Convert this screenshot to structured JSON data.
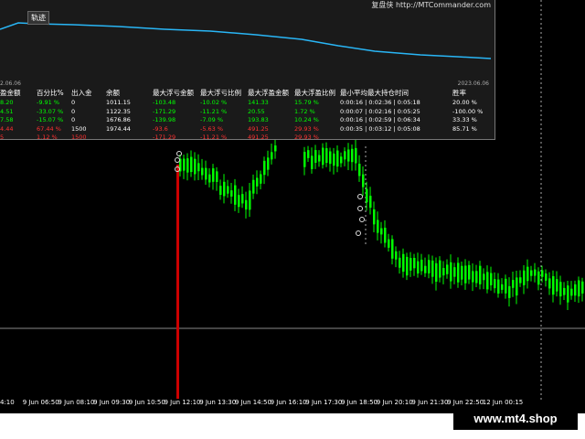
{
  "panel": {
    "title": "轨迹",
    "link": "复盘侠 http://MTCommander.com",
    "date_left": "2.06.06",
    "date_right": "2023.06.06"
  },
  "stats": {
    "headers": [
      "盈金额",
      "百分比%",
      "出入金",
      "余额",
      "最大浮亏金额",
      "最大浮亏比例",
      "最大浮盈金额",
      "最大浮盈比例",
      "最小平均最大持仓时间",
      "胜率"
    ],
    "rows": [
      {
        "color": "#00ff00",
        "cells": [
          "8.20",
          "-9.91 %",
          "0",
          "1011.15",
          "-103.48",
          "-10.02 %",
          "141.33",
          "15.79 %",
          "0:00:16 | 0:02:36 | 0:05:18",
          "20.00 %"
        ]
      },
      {
        "color": "#00ff00",
        "cells": [
          "4.51",
          "-33.07 %",
          "0",
          "1122.35",
          "-171.29",
          "-11.21 %",
          "20.55",
          "1.72 %",
          "0:00:07 | 0:02:16 | 0:05:25",
          "-100.00 %"
        ]
      },
      {
        "color": "#00ff00",
        "cells": [
          "7.58",
          "-15.07 %",
          "0",
          "1676.86",
          "-139.98",
          "-7.09 %",
          "193.83",
          "10.24 %",
          "0:00:16 | 0:02:59 | 0:06:34",
          "33.33 %"
        ]
      },
      {
        "color": "#ff3030",
        "cells": [
          "4.44",
          "67.44 %",
          "1500",
          "1974.44",
          "-93.6",
          "-5.63 %",
          "491.25",
          "29.93 %",
          "0:00:35 | 0:03:12 | 0:05:08",
          "85.71 %"
        ]
      },
      {
        "color": "#ff3030",
        "cells": [
          "5",
          "1.12 %",
          "1500",
          "",
          "-171.29",
          "-11.21 %",
          "491.25",
          "29.93 %",
          "",
          ""
        ]
      }
    ]
  },
  "time_axis": [
    "4:10",
    "9 Jun 06:50",
    "9 Jun 08:10",
    "9 Jun 09:30",
    "9 Jun 10:50",
    "9 Jun 12:10",
    "9 Jun 13:30",
    "9 Jun 14:50",
    "9 Jun 16:10",
    "9 Jun 17:30",
    "9 Jun 18:50",
    "9 Jun 20:10",
    "9 Jun 21:30",
    "9 Jun 22:50",
    "12 Jun 00:15"
  ],
  "watermark": "www.mt4.shop",
  "colors": {
    "candle": "#00ff00",
    "curve": "#29b6f6",
    "marker": "#cc0000"
  }
}
